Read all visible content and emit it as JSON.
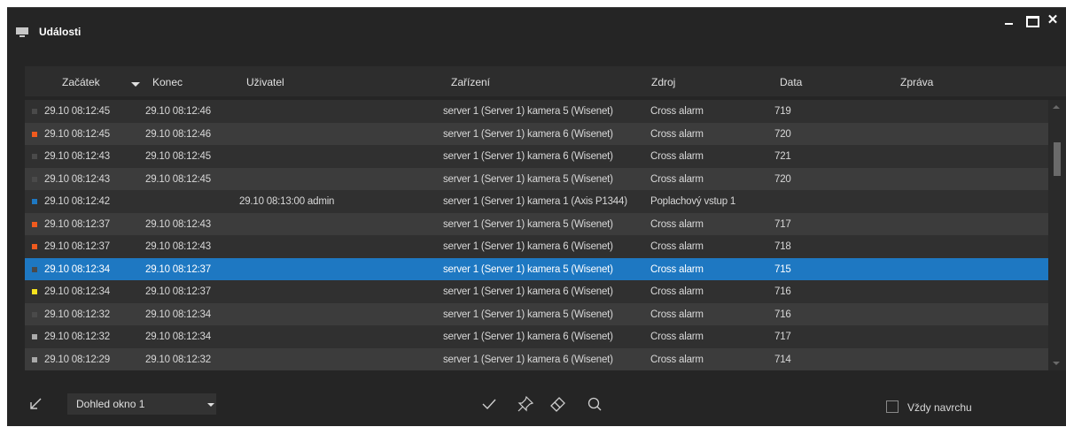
{
  "window": {
    "title": "Události",
    "close_glyph": "✕",
    "icons": [
      "monitor-icon",
      "minimize-icon",
      "maximize-icon",
      "close-icon"
    ]
  },
  "table": {
    "columns": {
      "start": "Začátek",
      "end": "Konec",
      "user": "Uživatel",
      "device": "Zařízení",
      "source": "Zdroj",
      "data": "Data",
      "message": "Zpráva"
    },
    "sort_column": "start",
    "rows": [
      {
        "status": "#4a4a4a",
        "start": "29.10 08:12:45",
        "end": "29.10 08:12:46",
        "user": "",
        "device": "server 1 (Server 1)  kamera 5 (Wisenet)",
        "source": "Cross alarm",
        "data": "719",
        "message": ""
      },
      {
        "status": "#f05a1e",
        "start": "29.10 08:12:45",
        "end": "29.10 08:12:46",
        "user": "",
        "device": "server 1 (Server 1)  kamera 6 (Wisenet)",
        "source": "Cross alarm",
        "data": "720",
        "message": ""
      },
      {
        "status": "#4a4a4a",
        "start": "29.10 08:12:43",
        "end": "29.10 08:12:45",
        "user": "",
        "device": "server 1 (Server 1)  kamera 6 (Wisenet)",
        "source": "Cross alarm",
        "data": "721",
        "message": ""
      },
      {
        "status": "#4a4a4a",
        "start": "29.10 08:12:43",
        "end": "29.10 08:12:45",
        "user": "",
        "device": "server 1 (Server 1)  kamera 5 (Wisenet)",
        "source": "Cross alarm",
        "data": "720",
        "message": ""
      },
      {
        "status": "#1e78c2",
        "start": "29.10 08:12:42",
        "end": "",
        "user": "29.10 08:13:00   admin",
        "device": "server 1 (Server 1)  kamera 1 (Axis P1344)",
        "source": "Poplachový vstup 1",
        "data": "",
        "message": ""
      },
      {
        "status": "#f05a1e",
        "start": "29.10 08:12:37",
        "end": "29.10 08:12:43",
        "user": "",
        "device": "server 1 (Server 1)  kamera 5 (Wisenet)",
        "source": "Cross alarm",
        "data": "717",
        "message": ""
      },
      {
        "status": "#f05a1e",
        "start": "29.10 08:12:37",
        "end": "29.10 08:12:43",
        "user": "",
        "device": "server 1 (Server 1)  kamera 6 (Wisenet)",
        "source": "Cross alarm",
        "data": "718",
        "message": ""
      },
      {
        "status": "#4a4a4a",
        "start": "29.10 08:12:34",
        "end": "29.10 08:12:37",
        "user": "",
        "device": "server 1 (Server 1)  kamera 5 (Wisenet)",
        "source": "Cross alarm",
        "data": "715",
        "message": "",
        "selected": true
      },
      {
        "status": "#f5e11e",
        "start": "29.10 08:12:34",
        "end": "29.10 08:12:37",
        "user": "",
        "device": "server 1 (Server 1)  kamera 6 (Wisenet)",
        "source": "Cross alarm",
        "data": "716",
        "message": ""
      },
      {
        "status": "#4a4a4a",
        "start": "29.10 08:12:32",
        "end": "29.10 08:12:34",
        "user": "",
        "device": "server 1 (Server 1)  kamera 5 (Wisenet)",
        "source": "Cross alarm",
        "data": "716",
        "message": ""
      },
      {
        "status": "#aaaaaa",
        "start": "29.10 08:12:32",
        "end": "29.10 08:12:34",
        "user": "",
        "device": "server 1 (Server 1)  kamera 6 (Wisenet)",
        "source": "Cross alarm",
        "data": "717",
        "message": ""
      },
      {
        "status": "#aaaaaa",
        "start": "29.10 08:12:29",
        "end": "29.10 08:12:32",
        "user": "",
        "device": "server 1 (Server 1)  kamera 6 (Wisenet)",
        "source": "Cross alarm",
        "data": "714",
        "message": ""
      }
    ]
  },
  "toolbar": {
    "view_select": "Dohled okno 1",
    "always_on_top_label": "Vždy navrchu",
    "always_on_top_checked": false,
    "icons": [
      "restore-arrow-icon",
      "checkmark-icon",
      "pin-icon",
      "eraser-icon",
      "search-icon"
    ]
  },
  "colors": {
    "background": "#252525",
    "selected_row": "#1e78c2",
    "row_odd": "#303030",
    "row_even": "#3c3c3c"
  }
}
